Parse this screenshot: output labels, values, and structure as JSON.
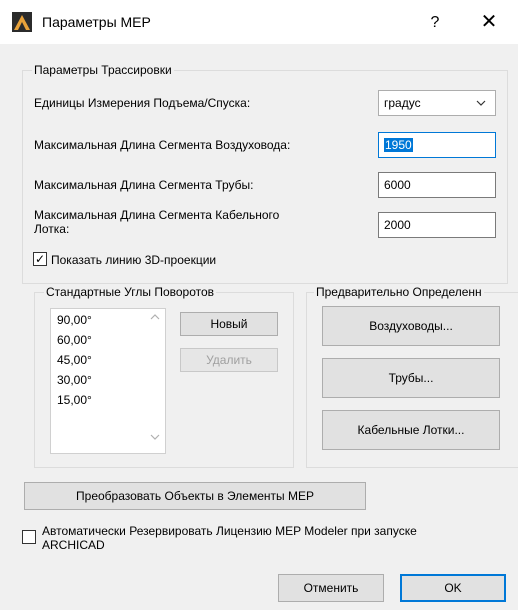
{
  "window": {
    "title": "Параметры MEP",
    "help_label": "?",
    "close_label": "✕"
  },
  "routing": {
    "group_label": "Параметры Трассировки",
    "units_label": "Единицы Измерения Подъема/Спуска:",
    "units_value": "градус",
    "duct_label": "Максимальная Длина Сегмента Воздуховода:",
    "duct_value": "1950",
    "pipe_label": "Максимальная Длина Сегмента Трубы:",
    "pipe_value": "6000",
    "cable_label_line1": "Максимальная Длина Сегмента Кабельного",
    "cable_label_line2": "Лотка:",
    "cable_value": "2000",
    "show3d_label": "Показать линию 3D-проекции",
    "show3d_checked": "✓"
  },
  "angles": {
    "group_label": "Стандартные Углы Поворотов",
    "items": [
      "90,00°",
      "60,00°",
      "45,00°",
      "30,00°",
      "15,00°"
    ],
    "new_button": "Новый",
    "delete_button": "Удалить"
  },
  "predefined": {
    "group_label": "Предварительно Определенн",
    "ducts_button": "Воздуховоды...",
    "pipes_button": "Трубы...",
    "cable_trays_button": "Кабельные Лотки..."
  },
  "convert_button": "Преобразовать Объекты в Элементы MEP",
  "auto_reserve": {
    "label_line1": "Автоматически Резервировать Лицензию MEP Modeler при запуске",
    "label_line2": "ARCHICAD"
  },
  "footer": {
    "cancel_button": "Отменить",
    "ok_button": "OK"
  },
  "colors": {
    "accent": "#0078d7",
    "client_bg": "#f0f0f0",
    "button_bg": "#e1e1e1"
  },
  "icons": {
    "app": "archicad-app-icon",
    "select": "chevron-down-icon",
    "scroll_up": "chevron-up-icon",
    "scroll_down": "chevron-down-icon"
  }
}
